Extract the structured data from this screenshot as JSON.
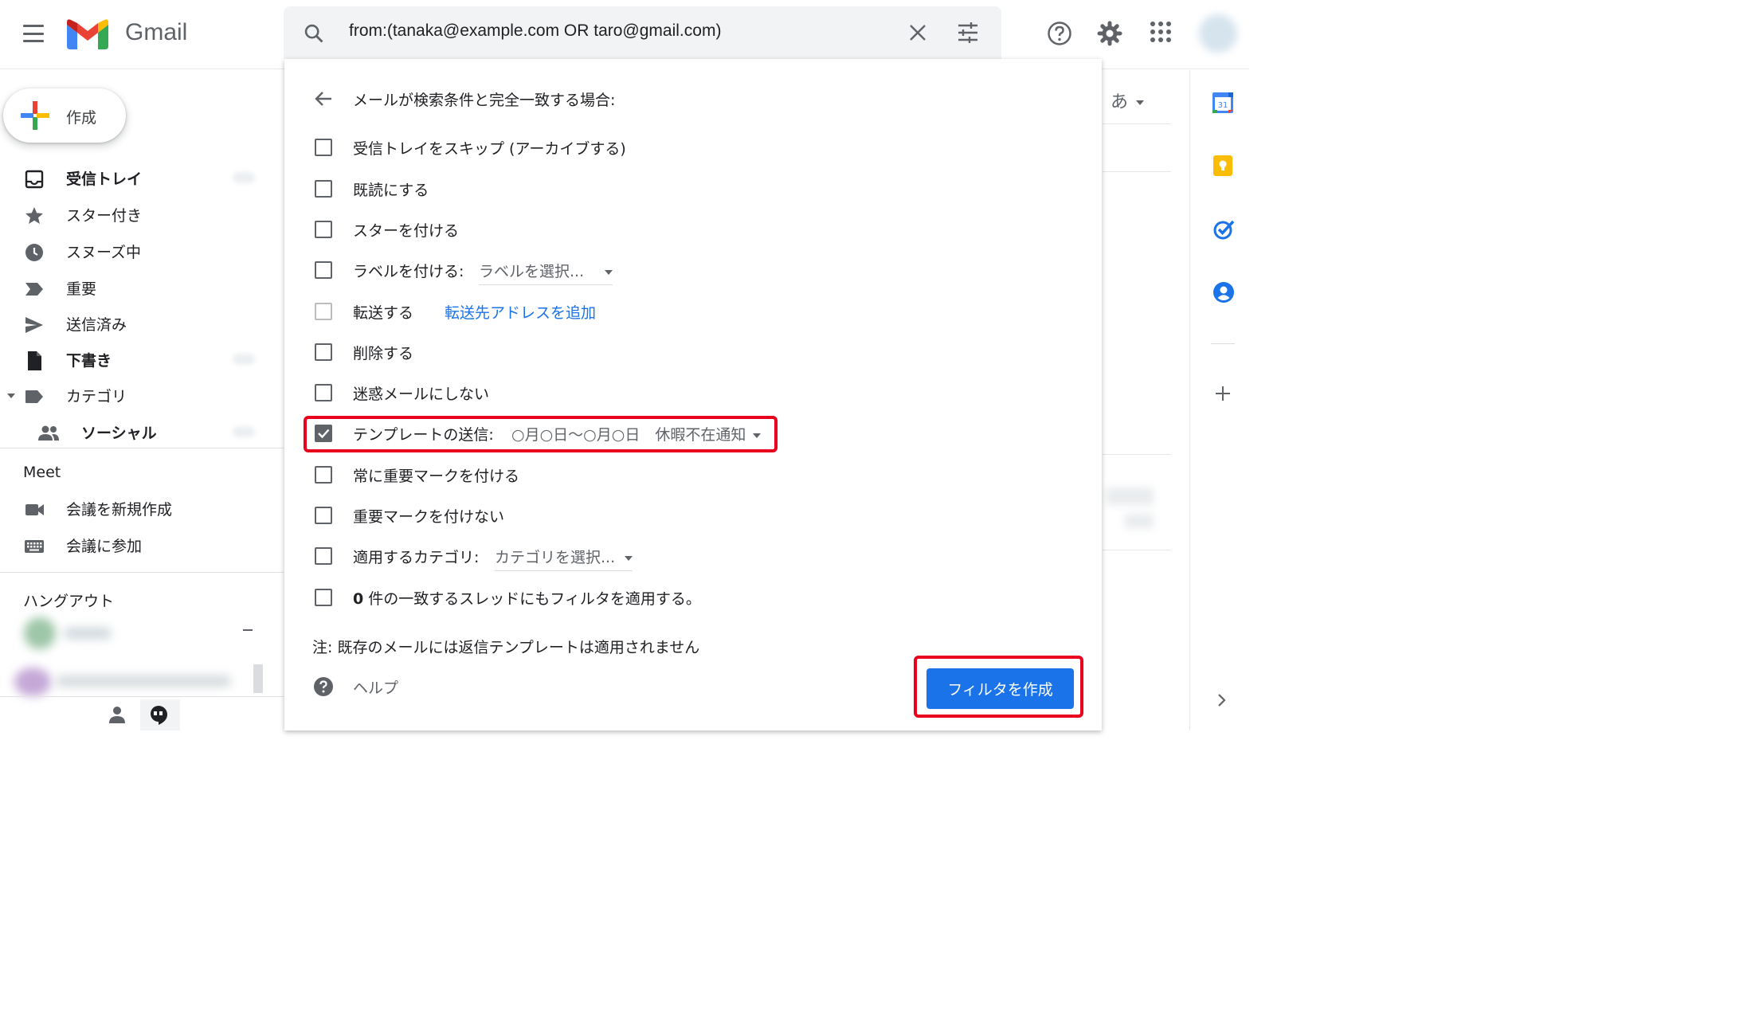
{
  "app": {
    "product_name": "Gmail",
    "accent": "#1a73e8",
    "highlight": "#e8001c"
  },
  "search": {
    "query": "from:(tanaka@example.com OR taro@gmail.com)"
  },
  "header_icons": [
    "help-icon",
    "settings-icon",
    "apps-grid-icon",
    "account-avatar"
  ],
  "sidebar": {
    "compose_label": "作成",
    "items": [
      {
        "label": "受信トレイ",
        "icon": "inbox-icon",
        "bold": true
      },
      {
        "label": "スター付き",
        "icon": "star-icon",
        "bold": false
      },
      {
        "label": "スヌーズ中",
        "icon": "clock-icon",
        "bold": false
      },
      {
        "label": "重要",
        "icon": "important-icon",
        "bold": false
      },
      {
        "label": "送信済み",
        "icon": "send-icon",
        "bold": false
      },
      {
        "label": "下書き",
        "icon": "draft-icon",
        "bold": true
      },
      {
        "label": "カテゴリ",
        "icon": "label-icon",
        "bold": false
      },
      {
        "label": "ソーシャル",
        "icon": "people-icon",
        "bold": true
      }
    ],
    "meet": {
      "title": "Meet",
      "new_meeting": "会議を新規作成",
      "join_meeting": "会議に参加"
    },
    "hangouts_title": "ハングアウト"
  },
  "background": {
    "input_tool": "あ"
  },
  "filter_panel": {
    "title": "メールが検索条件と完全一致する場合:",
    "options": {
      "skip_inbox": {
        "label": "受信トレイをスキップ (アーカイブする)",
        "checked": false
      },
      "mark_read": {
        "label": "既読にする",
        "checked": false
      },
      "star": {
        "label": "スターを付ける",
        "checked": false
      },
      "apply_label": {
        "label": "ラベルを付ける:",
        "select": "ラベルを選択...",
        "checked": false
      },
      "forward": {
        "label": "転送する",
        "link": "転送先アドレスを追加",
        "checked": false
      },
      "delete": {
        "label": "削除する",
        "checked": false
      },
      "never_spam": {
        "label": "迷惑メールにしない",
        "checked": false
      },
      "send_template": {
        "label": "テンプレートの送信:",
        "select": "○月○日〜○月○日　休暇不在通知",
        "checked": true
      },
      "always_important": {
        "label": "常に重要マークを付ける",
        "checked": false
      },
      "never_important": {
        "label": "重要マークを付けない",
        "checked": false
      },
      "category": {
        "label": "適用するカテゴリ:",
        "select": "カテゴリを選択...",
        "checked": false
      },
      "apply_existing": {
        "count": "0",
        "label": "件の一致するスレッドにもフィルタを適用する。",
        "checked": false
      }
    },
    "note": "注: 既存のメールには返信テンプレートは適用されません",
    "help": "ヘルプ",
    "create_button": "フィルタを作成"
  },
  "right_strip": {
    "calendar_day": "31",
    "icons": [
      "calendar-icon",
      "keep-icon",
      "tasks-icon",
      "contacts-icon",
      "add-icon",
      "expand-icon"
    ]
  }
}
